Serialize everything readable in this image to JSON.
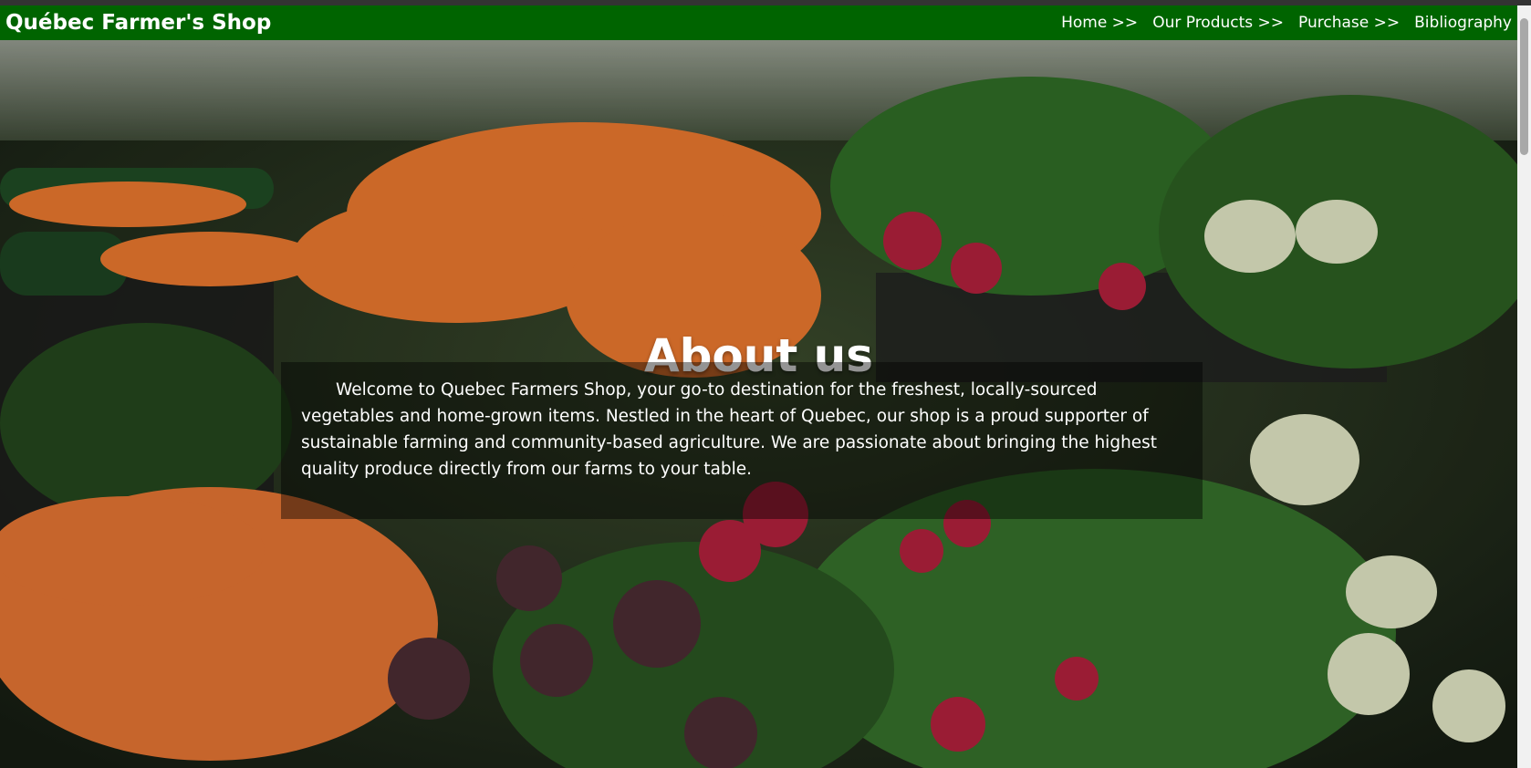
{
  "brand": "Québec Farmer's Shop",
  "nav": {
    "items": [
      {
        "label": "Home >>"
      },
      {
        "label": "Our Products >>"
      },
      {
        "label": "Purchase >>"
      },
      {
        "label": "Bibliography"
      }
    ]
  },
  "hero": {
    "title": "About us",
    "body": "Welcome to Quebec Farmers Shop, your go-to destination for the freshest, locally-sourced vegetables and home-grown items. Nestled in the heart of Quebec, our shop is a proud supporter of sustainable farming and community-based agriculture. We are passionate about bringing the highest quality produce directly from our farms to your table."
  },
  "colors": {
    "nav_bg": "#006400",
    "text": "#ffffff",
    "carrot": "#e8772e",
    "radish": "#b0203c",
    "greens": "#2f6b26"
  }
}
